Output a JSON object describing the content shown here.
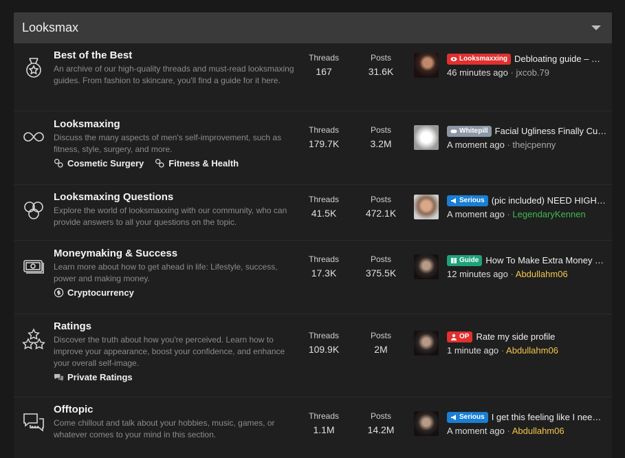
{
  "category": {
    "title": "Looksmax"
  },
  "labels": {
    "threads": "Threads",
    "posts": "Posts",
    "sep": "·"
  },
  "colors": {
    "header_bg": "#3a3a3a",
    "row_bg": "#1f1f1f",
    "link_green": "#3fb950",
    "link_gold": "#f4c64a"
  },
  "nodes": [
    {
      "icon": "medal-icon",
      "title": "Best of the Best",
      "desc": "An archive of our high-quality threads and must-read looksmaxing guides. From fashion to skincare, you'll find a guide for it here.",
      "threads": "167",
      "posts": "31.6K",
      "last": {
        "badge": "Looksmaxxing",
        "badge_color": "#e0302f",
        "badge_icon": "eye-icon",
        "title": "Debloating guide – …",
        "time": "46 minutes ago",
        "user": "jxcob.79",
        "user_color": "#a8a8a8"
      },
      "subs": []
    },
    {
      "icon": "infinity-icon",
      "title": "Looksmaxing",
      "desc": "Discuss the many aspects of men's self-improvement, such as fitness, style, surgery, and more.",
      "threads": "179.7K",
      "posts": "3.2M",
      "last": {
        "badge": "Whitepill",
        "badge_color": "#8c97a6",
        "badge_icon": "pill-icon",
        "title": "Facial Ugliness Finally Cu…",
        "time": "A moment ago",
        "user": "thejcpenny",
        "user_color": "#a8a8a8"
      },
      "subs": [
        "Cosmetic Surgery",
        "Fitness & Health"
      ]
    },
    {
      "icon": "circles-icon",
      "title": "Looksmaxing Questions",
      "desc": "Explore the world of looksmaxxing with our community, who can provide answers to all your questions on the topic.",
      "threads": "41.5K",
      "posts": "472.1K",
      "last": {
        "badge": "Serious",
        "badge_color": "#1a7fd4",
        "badge_icon": "megaphone-icon",
        "title": "(pic included) NEED HIGH …",
        "time": "A moment ago",
        "user": "LegendaryKennen",
        "user_color": "#3fb950"
      },
      "subs": []
    },
    {
      "icon": "money-icon",
      "title": "Moneymaking & Success",
      "desc": "Learn more about how to get ahead in life: Lifestyle, success, power and making money.",
      "threads": "17.3K",
      "posts": "375.5K",
      "last": {
        "badge": "Guide",
        "badge_color": "#1fa27a",
        "badge_icon": "book-icon",
        "title": "How To Make Extra Money …",
        "time": "12 minutes ago",
        "user": "Abdullahm06",
        "user_color": "#f4c64a"
      },
      "subs": [
        "Cryptocurrency"
      ]
    },
    {
      "icon": "stars-icon",
      "title": "Ratings",
      "desc": "Discover the truth about how you're perceived. Learn how to improve your appearance, boost your confidence, and enhance your overall self-image.",
      "threads": "109.9K",
      "posts": "2M",
      "last": {
        "badge": "OP",
        "badge_color": "#e0302f",
        "badge_icon": "user-icon",
        "title": "Rate my side profile",
        "time": "1 minute ago",
        "user": "Abdullahm06",
        "user_color": "#f4c64a"
      },
      "subs": [
        "Private Ratings"
      ]
    },
    {
      "icon": "chat-icon",
      "title": "Offtopic",
      "desc": "Come chillout and talk about your hobbies, music, games, or whatever comes to your mind in this section.",
      "threads": "1.1M",
      "posts": "14.2M",
      "last": {
        "badge": "Serious",
        "badge_color": "#1a7fd4",
        "badge_icon": "megaphone-icon",
        "title": "I get this feeling like I nee…",
        "time": "A moment ago",
        "user": "Abdullahm06",
        "user_color": "#f4c64a"
      },
      "subs": []
    }
  ]
}
